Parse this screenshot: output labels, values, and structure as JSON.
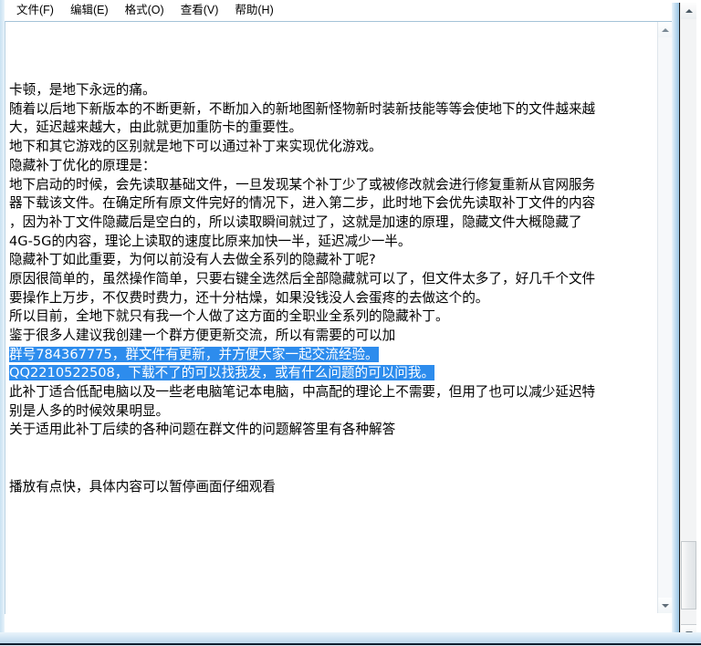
{
  "window": {
    "app": "notepad",
    "frame_color": "#cfe4f3"
  },
  "menubar": {
    "items": [
      {
        "label": "文件(F)",
        "name": "menu-file"
      },
      {
        "label": "编辑(E)",
        "name": "menu-edit"
      },
      {
        "label": "格式(O)",
        "name": "menu-format"
      },
      {
        "label": "查看(V)",
        "name": "menu-view"
      },
      {
        "label": "帮助(H)",
        "name": "menu-help"
      }
    ]
  },
  "editor": {
    "selection_color": "#2d8ced",
    "selection_text_color": "#ffffff",
    "text_color": "#000000",
    "background": "#ffffff",
    "lines": [
      {
        "text": "",
        "selected": false
      },
      {
        "text": "",
        "selected": false
      },
      {
        "text": "",
        "selected": false
      },
      {
        "text": "卡顿，是地下永远的痛。",
        "selected": false
      },
      {
        "text": "随着以后地下新版本的不断更新，不断加入的新地图新怪物新时装新技能等等会使地下的文件越来越",
        "selected": false
      },
      {
        "text": "大，延迟越来越大，由此就更加重防卡的重要性。",
        "selected": false
      },
      {
        "text": "地下和其它游戏的区别就是地下可以通过补丁来实现优化游戏。",
        "selected": false
      },
      {
        "text": "隐藏补丁优化的原理是：",
        "selected": false
      },
      {
        "text": "地下启动的时候，会先读取基础文件，一旦发现某个补丁少了或被修改就会进行修复重新从官网服务",
        "selected": false
      },
      {
        "text": "器下载该文件。在确定所有原文件完好的情况下，进入第二步，此时地下会优先读取补丁文件的内容",
        "selected": false
      },
      {
        "text": "，因为补丁文件隐藏后是空白的，所以读取瞬间就过了，这就是加速的原理，隐藏文件大概隐藏了",
        "selected": false
      },
      {
        "text": "4G-5G的内容，理论上读取的速度比原来加快一半，延迟减少一半。",
        "selected": false
      },
      {
        "text": "隐藏补丁如此重要，为何以前没有人去做全系列的隐藏补丁呢?",
        "selected": false
      },
      {
        "text": "原因很简单的，虽然操作简单，只要右键全选然后全部隐藏就可以了，但文件太多了，好几千个文件",
        "selected": false
      },
      {
        "text": "要操作上万步，不仅费时费力，还十分枯燥，如果没钱没人会蛋疼的去做这个的。",
        "selected": false
      },
      {
        "text": "所以目前，全地下就只有我一个人做了这方面的全职业全系列的隐藏补丁。",
        "selected": false
      },
      {
        "text": "鉴于很多人建议我创建一个群方便更新交流，所以有需要的可以加",
        "selected": false
      },
      {
        "text": "群号784367775，群文件有更新，并方便大家一起交流经验。",
        "selected": true
      },
      {
        "text": "QQ2210522508，下载不了的可以找我发，或有什么问题的可以问我。",
        "selected": true
      },
      {
        "text": "此补丁适合低配电脑以及一些老电脑笔记本电脑，中高配的理论上不需要，但用了也可以减少延迟特",
        "selected": false
      },
      {
        "text": "别是人多的时候效果明显。",
        "selected": false
      },
      {
        "text": "关于适用此补丁后续的各种问题在群文件的问题解答里有各种解答",
        "selected": false
      },
      {
        "text": "",
        "selected": false
      },
      {
        "text": "",
        "selected": false
      },
      {
        "text": "播放有点快，具体内容可以暂停画面仔细观看",
        "selected": false
      }
    ]
  },
  "scrollbars": {
    "inner": {
      "up_arrow": "arrow-up-icon",
      "down_arrow": "arrow-down-icon"
    },
    "outer": {
      "up_arrow": "arrow-up-icon",
      "down_arrow": "arrow-down-icon",
      "thumb_position": "bottom"
    }
  }
}
